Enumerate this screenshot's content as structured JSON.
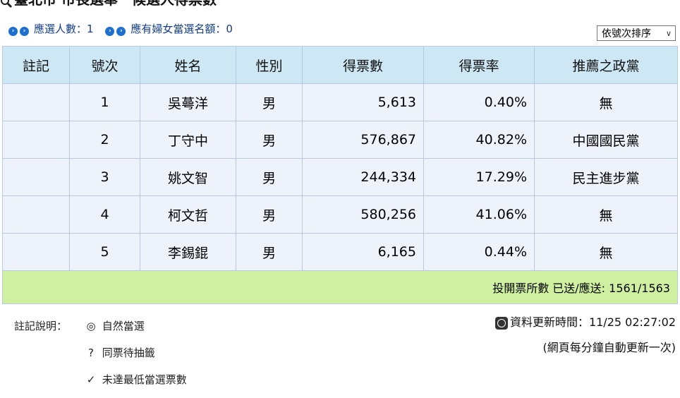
{
  "header": {
    "title": "臺北市 市長選舉　候選人得票數",
    "elected_count": "應選人數：1",
    "women_quota": "應有婦女當選名額：0",
    "sort_label": "依號次排序"
  },
  "table": {
    "columns": [
      "註記",
      "號次",
      "姓名",
      "性別",
      "得票數",
      "得票率",
      "推薦之政黨"
    ],
    "rows": [
      {
        "note": "",
        "num": "1",
        "name": "吳蕚洋",
        "gender": "男",
        "votes": "5,613",
        "rate": "0.40%",
        "party": "無"
      },
      {
        "note": "",
        "num": "2",
        "name": "丁守中",
        "gender": "男",
        "votes": "576,867",
        "rate": "40.82%",
        "party": "中國國民黨"
      },
      {
        "note": "",
        "num": "3",
        "name": "姚文智",
        "gender": "男",
        "votes": "244,334",
        "rate": "17.29%",
        "party": "民主進步黨"
      },
      {
        "note": "",
        "num": "4",
        "name": "柯文哲",
        "gender": "男",
        "votes": "580,256",
        "rate": "41.06%",
        "party": "無"
      },
      {
        "note": "",
        "num": "5",
        "name": "李錫錕",
        "gender": "男",
        "votes": "6,165",
        "rate": "0.44%",
        "party": "無"
      }
    ],
    "footer": "投開票所數 已送/應送: 1561/1563"
  },
  "notes": {
    "label": "註記說明：",
    "items": [
      {
        "symbol": "◎",
        "text": "自然當選"
      },
      {
        "symbol": "?",
        "text": "同票待抽籤"
      },
      {
        "symbol": "✓",
        "text": "未達最低當選票數"
      }
    ]
  },
  "update": {
    "time": "資料更新時間：11/25 02:27:02",
    "auto": "(網頁每分鐘自動更新一次)"
  },
  "colors": {
    "header_bg": "#cde7f4",
    "row_bg": "#eef3fb",
    "footer_bg": "#cef0a0",
    "info_text": "#123c8a"
  }
}
